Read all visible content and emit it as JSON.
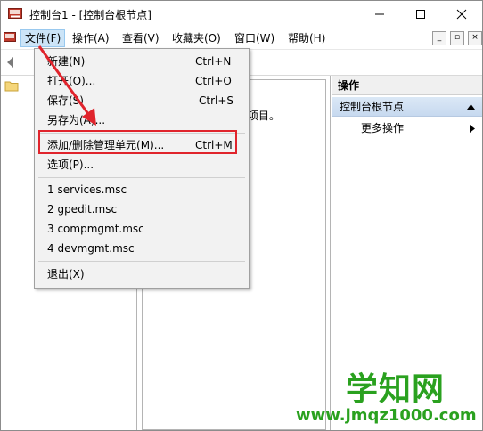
{
  "window": {
    "title": "控制台1 - [控制台根节点]",
    "accent": "#ffffff"
  },
  "menubar": {
    "items": [
      "文件(F)",
      "操作(A)",
      "查看(V)",
      "收藏夹(O)",
      "窗口(W)",
      "帮助(H)"
    ],
    "mdi_buttons": [
      "_",
      "▫",
      "×"
    ]
  },
  "center": {
    "text": "项目。"
  },
  "actions": {
    "header": "操作",
    "section": "控制台根节点",
    "more": "更多操作"
  },
  "file_menu": {
    "items": [
      {
        "label": "新建(N)",
        "shortcut": "Ctrl+N"
      },
      {
        "label": "打开(O)...",
        "shortcut": "Ctrl+O"
      },
      {
        "label": "保存(S)",
        "shortcut": "Ctrl+S"
      },
      {
        "label": "另存为(A)...",
        "shortcut": ""
      },
      {
        "label": "添加/删除管理单元(M)...",
        "shortcut": "Ctrl+M"
      },
      {
        "label": "选项(P)...",
        "shortcut": ""
      },
      {
        "label": "1 services.msc",
        "shortcut": ""
      },
      {
        "label": "2 gpedit.msc",
        "shortcut": ""
      },
      {
        "label": "3 compmgmt.msc",
        "shortcut": ""
      },
      {
        "label": "4 devmgmt.msc",
        "shortcut": ""
      },
      {
        "label": "退出(X)",
        "shortcut": ""
      }
    ]
  },
  "annotation": {
    "highlight_color": "#e0242c"
  },
  "watermark": {
    "title": "学知网",
    "url": "www.jmqz1000.com"
  }
}
